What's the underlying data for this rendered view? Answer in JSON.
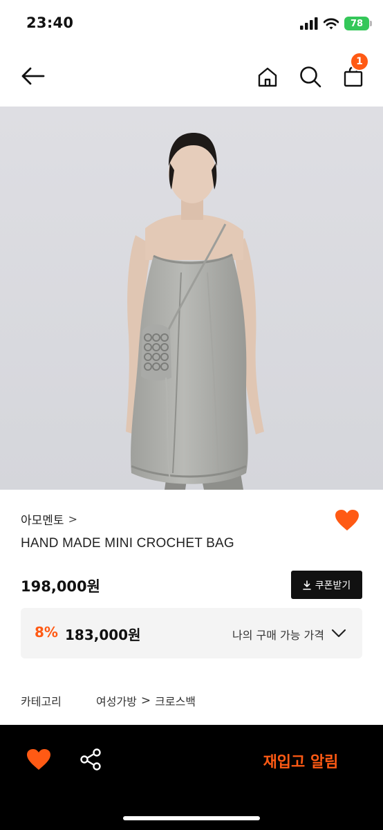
{
  "status_bar": {
    "time": "23:40",
    "battery": "78",
    "icons": [
      "signal-icon",
      "wifi-icon",
      "battery-icon"
    ]
  },
  "nav": {
    "icons": [
      "back-arrow-icon",
      "home-icon",
      "search-icon",
      "shopping-bag-icon"
    ],
    "cart_badge": "1"
  },
  "product": {
    "brand": "아모멘토",
    "brand_chevron": ">",
    "name": "HAND MADE MINI CROCHET BAG",
    "price": "198,000원",
    "coupon_label": "쿠폰받기",
    "discount": "8%",
    "sale_price": "183,000원",
    "buy_price_label": "나의 구매 가능 가격"
  },
  "category": {
    "label": "카테고리",
    "path": [
      "여성가방",
      "크로스백"
    ],
    "separator": ">"
  },
  "bottom_bar": {
    "restock_label": "재입고 알림"
  },
  "colors": {
    "accent": "#ff5a14",
    "dark": "#111111",
    "image_bg": "#dcdce1",
    "box_bg": "#f4f4f4"
  }
}
